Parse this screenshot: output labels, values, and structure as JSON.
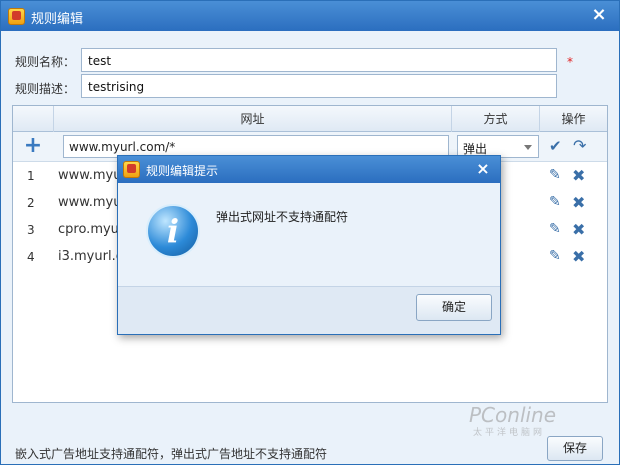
{
  "window": {
    "title": "规则编辑",
    "close_label": "×"
  },
  "form": {
    "name_label": "规则名称：",
    "name_value": "test",
    "required_mark": "*",
    "desc_label": "规则描述：",
    "desc_value": "testrising"
  },
  "table": {
    "headers": {
      "url": "网址",
      "mode": "方式",
      "actions": "操作"
    },
    "new_row": {
      "url_value": "www.myurl.com/*",
      "mode_value": "弹出"
    },
    "rows": [
      {
        "num": "1",
        "url": "www.myurl"
      },
      {
        "num": "2",
        "url": "www.myurl"
      },
      {
        "num": "3",
        "url": "cpro.myurl"
      },
      {
        "num": "4",
        "url": "i3.myurl.cn"
      }
    ]
  },
  "footer": {
    "note": "嵌入式广告地址支持通配符，弹出式广告地址不支持通配符",
    "save_label": "保存",
    "watermark": "PConline",
    "watermark_sub": "太平洋电脑网"
  },
  "dialog": {
    "title": "规则编辑提示",
    "close_label": "×",
    "message": "弹出式网址不支持通配符",
    "ok_label": "确定",
    "icon": "info-icon"
  },
  "colors": {
    "titlebar": "#2b6ebf",
    "required": "#e02020",
    "accent": "#3a6fa8"
  }
}
